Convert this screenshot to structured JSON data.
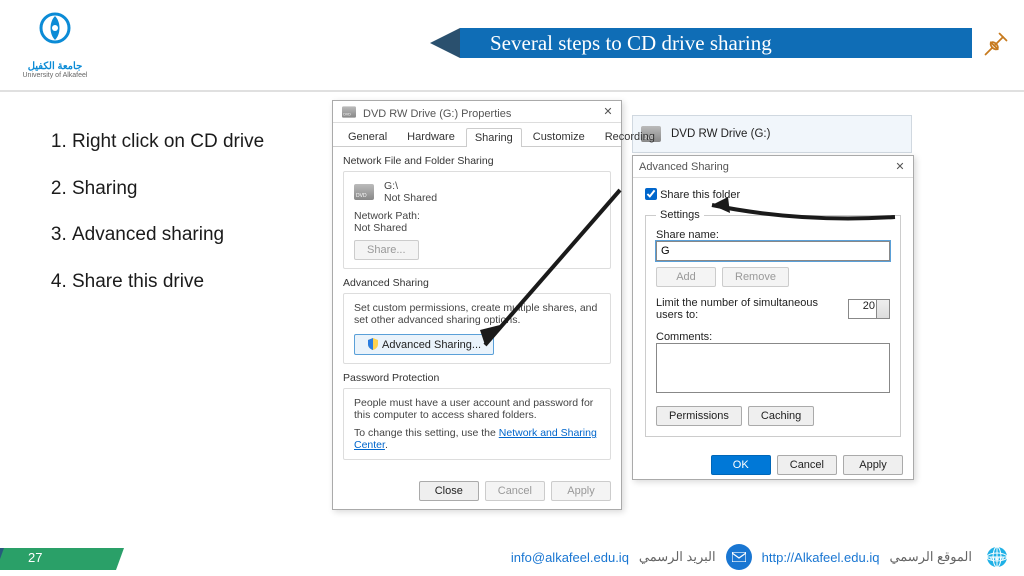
{
  "logo": {
    "ar": "جامعة الكفيل",
    "en": "University of Alkafeel"
  },
  "title": "Several steps to CD drive sharing",
  "steps": [
    "Right click on CD drive",
    "Sharing",
    "Advanced sharing",
    "Share this drive"
  ],
  "drive_header": {
    "label": "DVD RW Drive (G:)"
  },
  "prop": {
    "title": "DVD RW Drive (G:) Properties",
    "tabs": [
      "General",
      "Hardware",
      "Sharing",
      "Customize",
      "Recording"
    ],
    "active_tab": 2,
    "nfs": {
      "heading": "Network File and Folder Sharing",
      "path_label": "G:\\",
      "status": "Not Shared",
      "netpath_label": "Network Path:",
      "netpath_value": "Not Shared",
      "share_btn": "Share..."
    },
    "adv": {
      "heading": "Advanced Sharing",
      "desc": "Set custom permissions, create multiple shares, and set other advanced sharing options.",
      "btn": "Advanced Sharing..."
    },
    "pwd": {
      "heading": "Password Protection",
      "desc": "People must have a user account and password for this computer to access shared folders.",
      "link_prefix": "To change this setting, use the ",
      "link": "Network and Sharing Center"
    },
    "buttons": {
      "close": "Close",
      "cancel": "Cancel",
      "apply": "Apply"
    }
  },
  "advdlg": {
    "title": "Advanced Sharing",
    "share_chk": "Share this folder",
    "settings_legend": "Settings",
    "sharename_label": "Share name:",
    "sharename_value": "G",
    "add": "Add",
    "remove": "Remove",
    "limit_label": "Limit the number of simultaneous users to:",
    "limit_value": "20",
    "comments_label": "Comments:",
    "perm": "Permissions",
    "cache": "Caching",
    "ok": "OK",
    "cancel": "Cancel",
    "apply": "Apply"
  },
  "footer": {
    "page": "27",
    "email": "info@alkafeel.edu.iq",
    "email_ar": "البريد الرسمي",
    "site": "http://Alkafeel.edu.iq",
    "site_ar": "الموقع الرسمي"
  }
}
